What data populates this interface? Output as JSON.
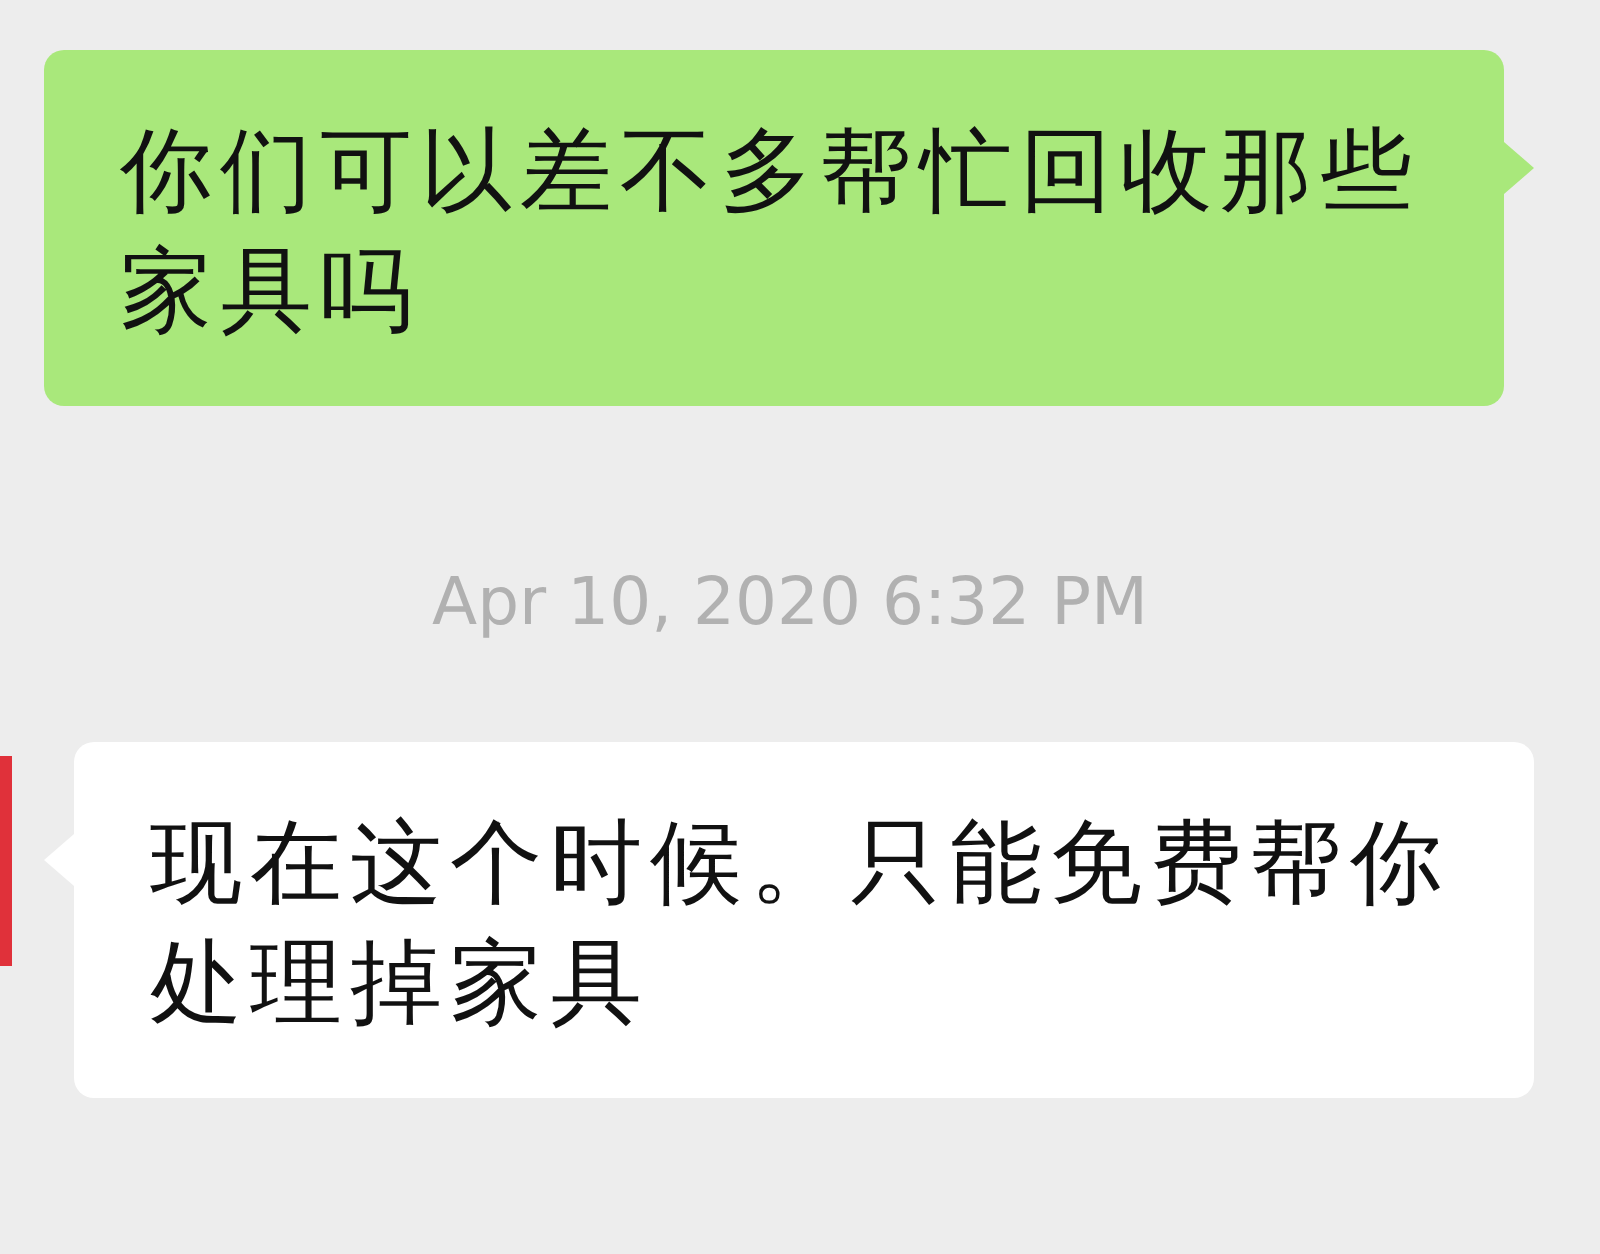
{
  "messages": [
    {
      "kind": "sent",
      "text": "你们可以差不多帮忙回收那些家具吗"
    },
    {
      "kind": "timestamp",
      "text": "Apr 10, 2020 6:32 PM"
    },
    {
      "kind": "received",
      "text": "现在这个时候。只能免费帮你处理掉家具"
    }
  ]
}
